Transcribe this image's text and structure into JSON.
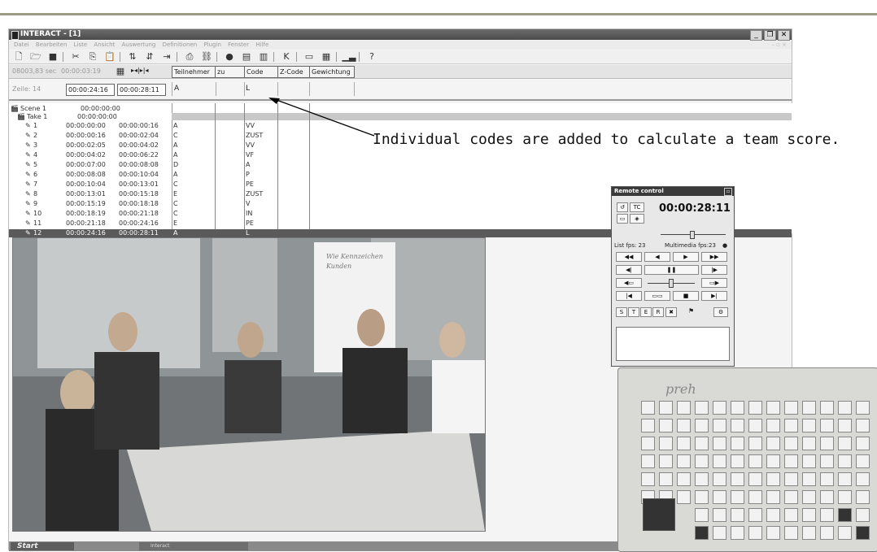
{
  "window": {
    "title": "INTERACT - [1]"
  },
  "menu": [
    "Datei",
    "Bearbeiten",
    "Liste",
    "Ansicht",
    "Auswertung",
    "Definitionen",
    "Plugin",
    "Fenster",
    "Hilfe"
  ],
  "status": {
    "seconds": "08003,83 sec",
    "time": "00:00:03:19"
  },
  "columns": [
    "Teilnehmer",
    "zu wem",
    "Code",
    "Z-Code",
    "Gewichtung"
  ],
  "current": {
    "line": "Zeile: 14",
    "start": "00:00:24:16",
    "end": "00:00:28:11",
    "participant": "A",
    "code": "L"
  },
  "tree": {
    "scene": "Scene 1",
    "scene_time": "00:00:00:00",
    "take": "Take 1",
    "take_time": "00:00:00:00"
  },
  "events": [
    {
      "n": "1",
      "start": "00:00:00:00",
      "end": "00:00:00:16",
      "p": "A",
      "code": "VV"
    },
    {
      "n": "2",
      "start": "00:00:00:16",
      "end": "00:00:02:04",
      "p": "C",
      "code": "ZUST"
    },
    {
      "n": "3",
      "start": "00:00:02:05",
      "end": "00:00:04:02",
      "p": "A",
      "code": "VV"
    },
    {
      "n": "4",
      "start": "00:00:04:02",
      "end": "00:00:06:22",
      "p": "A",
      "code": "VF"
    },
    {
      "n": "5",
      "start": "00:00:07:00",
      "end": "00:00:08:08",
      "p": "D",
      "code": "A"
    },
    {
      "n": "6",
      "start": "00:00:08:08",
      "end": "00:00:10:04",
      "p": "A",
      "code": "P"
    },
    {
      "n": "7",
      "start": "00:00:10:04",
      "end": "00:00:13:01",
      "p": "C",
      "code": "PE"
    },
    {
      "n": "8",
      "start": "00:00:13:01",
      "end": "00:00:15:18",
      "p": "E",
      "code": "ZUST"
    },
    {
      "n": "9",
      "start": "00:00:15:19",
      "end": "00:00:18:18",
      "p": "C",
      "code": "V"
    },
    {
      "n": "10",
      "start": "00:00:18:19",
      "end": "00:00:21:18",
      "p": "C",
      "code": "IN"
    },
    {
      "n": "11",
      "start": "00:00:21:18",
      "end": "00:00:24:16",
      "p": "E",
      "code": "PE"
    },
    {
      "n": "12",
      "start": "00:00:24:16",
      "end": "00:00:28:11",
      "p": "A",
      "code": "L"
    }
  ],
  "annotation": "Individual codes are added to calculate a team score.",
  "remote": {
    "title": "Remote control",
    "tc": "TC",
    "time": "00:00:28:11",
    "fps": "List fps: 23",
    "multimedia_fps": "Multimedia fps:23",
    "letters": [
      "S",
      "T",
      "E",
      "R"
    ]
  },
  "taskbar": {
    "start": "Start",
    "item": "Interact"
  },
  "keypad": {
    "brand": "preh"
  },
  "colors": {
    "selected_row": "#5a5a5a",
    "title_bar": "#4b4b4b",
    "annotation_text": "#111111"
  }
}
